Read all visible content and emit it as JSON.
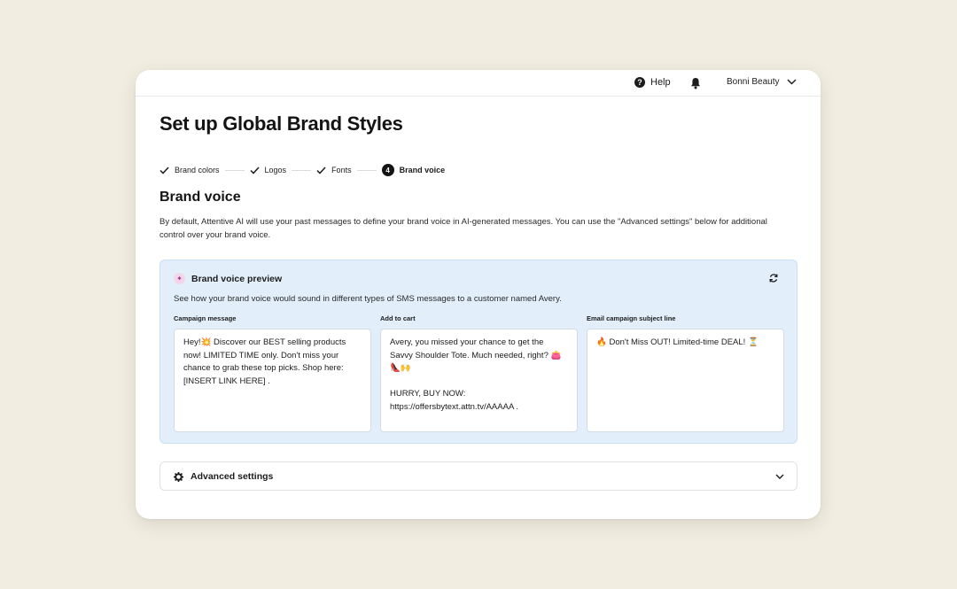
{
  "topbar": {
    "help_label": "Help",
    "help_icon": "?",
    "account_name": "Bonni Beauty"
  },
  "page": {
    "title": "Set up Global Brand Styles"
  },
  "stepper": {
    "steps": [
      {
        "label": "Brand colors",
        "state": "complete"
      },
      {
        "label": "Logos",
        "state": "complete"
      },
      {
        "label": "Fonts",
        "state": "complete"
      },
      {
        "label": "Brand voice",
        "state": "active",
        "number": "4"
      }
    ]
  },
  "section": {
    "title": "Brand voice",
    "description": "By default, Attentive AI will use your past messages to define your brand voice in AI-generated messages. You can use the \"Advanced settings\" below for additional control over your brand voice."
  },
  "preview": {
    "title": "Brand voice preview",
    "subtitle": "See how your brand voice would sound in different types of SMS messages to a customer named Avery.",
    "columns": [
      {
        "label": "Campaign message",
        "text": "Hey!💥 Discover our BEST selling products now! LIMITED TIME only. Don't miss your chance to grab these top picks. Shop here: [INSERT LINK HERE] ."
      },
      {
        "label": "Add to cart",
        "text": "Avery, you missed your chance to get the Savvy Shoulder Tote. Much needed, right? 👛👠🙌\n\nHURRY, BUY NOW: https://offersbytext.attn.tv/AAAAA ."
      },
      {
        "label": "Email campaign subject line",
        "text": "🔥 Don't Miss OUT! Limited-time DEAL! ⏳"
      }
    ]
  },
  "advanced": {
    "label": "Advanced settings"
  },
  "colors": {
    "background": "#f1ede0",
    "preview_bg": "#e2effb",
    "preview_border": "#c9dff3",
    "ink": "#141414"
  }
}
